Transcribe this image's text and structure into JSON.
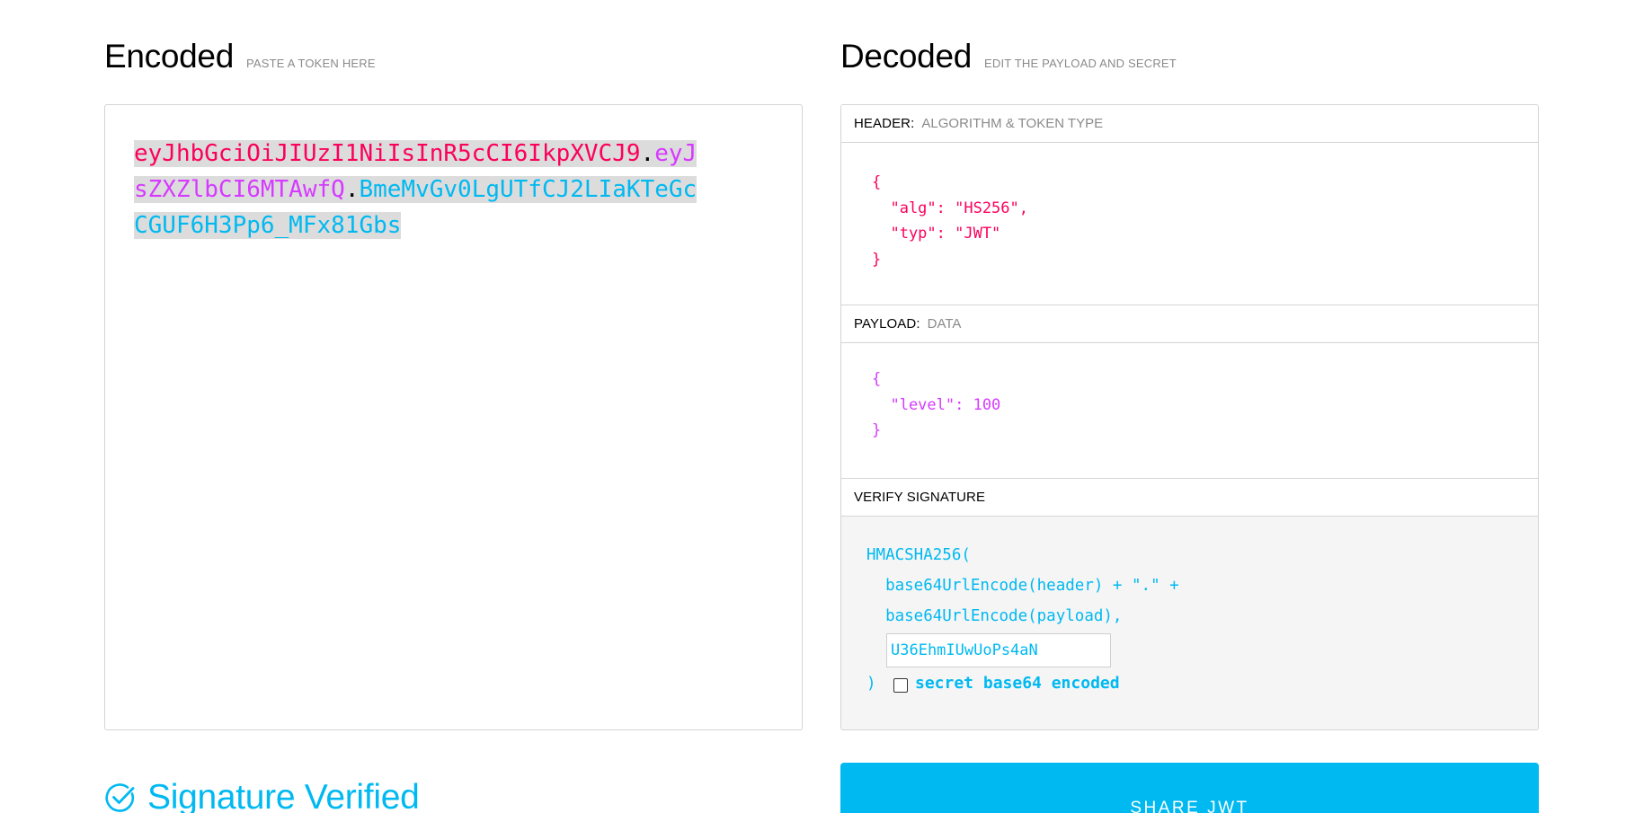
{
  "encoded": {
    "title": "Encoded",
    "subtitle": "PASTE A TOKEN HERE",
    "token": {
      "header": "eyJhbGciOiJIUzI1NiIsInR5cCI6IkpXVCJ9",
      "dot1": ".",
      "payload": "eyJsZXZlbCI6MTAwfQ",
      "dot2": ".",
      "signature": "BmeMvGv0LgUTfCJ2LIaKTeGcCGUF6H3Pp6_MFx81Gbs"
    }
  },
  "decoded": {
    "title": "Decoded",
    "subtitle": "EDIT THE PAYLOAD AND SECRET",
    "header_section": {
      "label": "HEADER:",
      "desc": "ALGORITHM & TOKEN TYPE",
      "json": "{\n  \"alg\": \"HS256\",\n  \"typ\": \"JWT\"\n}"
    },
    "payload_section": {
      "label": "PAYLOAD:",
      "desc": "DATA",
      "json": "{\n  \"level\": 100\n}"
    },
    "verify_section": {
      "label": "VERIFY SIGNATURE",
      "line1": "HMACSHA256(",
      "line2": "  base64UrlEncode(header) + \".\" +",
      "line3": "  base64UrlEncode(payload),",
      "secret_value": "U36EhmIUwUoPs4aN",
      "close": ")",
      "checkbox_label": "secret base64 encoded"
    }
  },
  "status": {
    "text": "Signature Verified",
    "icon": "check-circle-icon"
  },
  "share_button": "SHARE JWT",
  "colors": {
    "header": "#fb015b",
    "payload": "#d63aff",
    "signature": "#00b9f1"
  }
}
